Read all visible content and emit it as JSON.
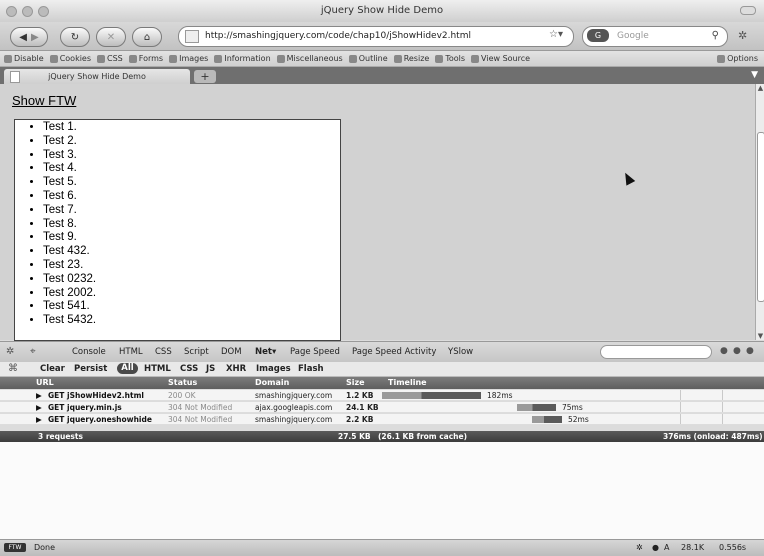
{
  "window": {
    "title": "jQuery Show Hide Demo"
  },
  "nav": {
    "url": "http://smashingjquery.com/code/chap10/jShowHidev2.html",
    "search_placeholder": "Google",
    "search_engine": "G"
  },
  "toolbar": {
    "items": [
      "Disable",
      "Cookies",
      "CSS",
      "Forms",
      "Images",
      "Information",
      "Miscellaneous",
      "Outline",
      "Resize",
      "Tools",
      "View Source"
    ],
    "options": "Options"
  },
  "tabs": [
    {
      "label": "jQuery Show Hide Demo"
    }
  ],
  "page": {
    "show_link": "Show FTW",
    "list_items": [
      "Test 1.",
      "Test 2.",
      "Test 3.",
      "Test 4.",
      "Test 5.",
      "Test 6.",
      "Test 7.",
      "Test 8.",
      "Test 9.",
      "Test 432.",
      "Test 23.",
      "Test 0232.",
      "Test 2002.",
      "Test 541.",
      "Test 5432."
    ]
  },
  "firebug": {
    "panels": [
      "Console",
      "HTML",
      "CSS",
      "Script",
      "DOM",
      "Net",
      "Page Speed",
      "Page Speed Activity",
      "YSlow"
    ],
    "active_panel": "Net",
    "net_controls": [
      "Clear",
      "Persist"
    ],
    "filters": [
      "All",
      "HTML",
      "CSS",
      "JS",
      "XHR",
      "Images",
      "Flash"
    ],
    "columns": [
      "URL",
      "Status",
      "Domain",
      "Size",
      "Timeline"
    ],
    "requests": [
      {
        "url": "GET jShowHidev2.html",
        "status": "200 OK",
        "domain": "smashingjquery.com",
        "size": "1.2 KB",
        "time": "182ms",
        "bar_start": 0.0,
        "bar_end": 0.33
      },
      {
        "url": "GET jquery.min.js",
        "status": "304 Not Modified",
        "domain": "ajax.googleapis.com",
        "size": "24.1 KB",
        "time": "75ms",
        "bar_start": 0.45,
        "bar_end": 0.58
      },
      {
        "url": "GET jquery.oneshowhide",
        "status": "304 Not Modified",
        "domain": "smashingjquery.com",
        "size": "2.2 KB",
        "time": "52ms",
        "bar_start": 0.5,
        "bar_end": 0.6
      }
    ],
    "summary": {
      "count": "3 requests",
      "total": "27.5 KB",
      "cached": "(26.1 KB from cache)",
      "timing": "376ms (onload: 487ms)"
    }
  },
  "status": {
    "text": "Done",
    "badge": "FTW",
    "size": "28.1K",
    "time": "0.556s",
    "yslow": "A"
  },
  "colors": {
    "tab_strip": "#6f6f6f",
    "net_header": "#6a6a6a",
    "bar_receive": "#5a5a5a"
  }
}
